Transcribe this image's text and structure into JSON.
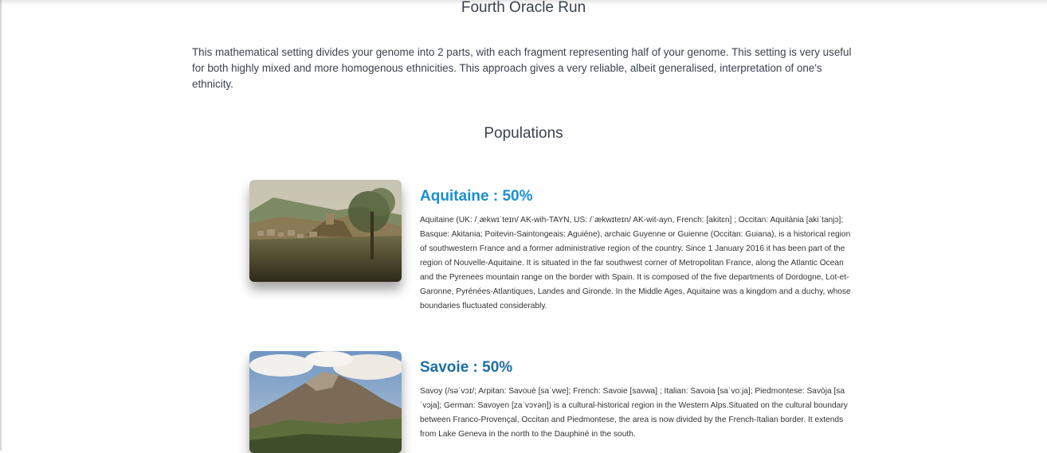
{
  "header": {
    "run_title": "Fourth Oracle Run",
    "intro": "This mathematical setting divides your genome into 2 parts, with each fragment representing half of your genome. This setting is very useful for both highly mixed and more homogenous ethnicities. This approach gives a very reliable, albeit generalised, interpretation of one's ethnicity."
  },
  "populations": {
    "heading": "Populations",
    "items": [
      {
        "title": "Aquitaine : 50%",
        "image": "aquitaine-landscape-photo",
        "description": "Aquitaine (UK: /ˌækwɪˈteɪn/ AK-wih-TAYN, US: /ˈækwɪteɪn/ AK-wit-ayn, French: [akitɛn] ; Occitan: Aquitània [akiˈtanjɔ]; Basque: Akitania; Poitevin-Saintongeais: Aguiéne), archaic Guyenne or Guienne (Occitan: Guiana), is a historical region of southwestern France and a former administrative region of the country. Since 1 January 2016 it has been part of the region of Nouvelle-Aquitaine. It is situated in the far southwest corner of Metropolitan France, along the Atlantic Ocean and the Pyrenees mountain range on the border with Spain. It is composed of the five departments of Dordogne, Lot-et-Garonne, Pyrénées-Atlantiques, Landes and Gironde. In the Middle Ages, Aquitaine was a kingdom and a duchy, whose boundaries fluctuated considerably."
      },
      {
        "title": "Savoie : 50%",
        "image": "savoie-mountain-photo",
        "description": "Savoy (/səˈvɔɪ/; Arpitan: Savouè [saˈvwe]; French: Savoie [savwa] ; Italian: Savoia [saˈvoːja]; Piedmontese: Savòja [saˈvɔja]; German: Savoyen [zaˈvɔʏən]) is a cultural-historical region in the Western Alps.Situated on the cultural boundary between Franco-Provençal, Occitan and Piedmontese, the area is now divided by the French-Italian border. It extends from Lake Geneva in the north to the Dauphiné in the south."
      }
    ]
  }
}
